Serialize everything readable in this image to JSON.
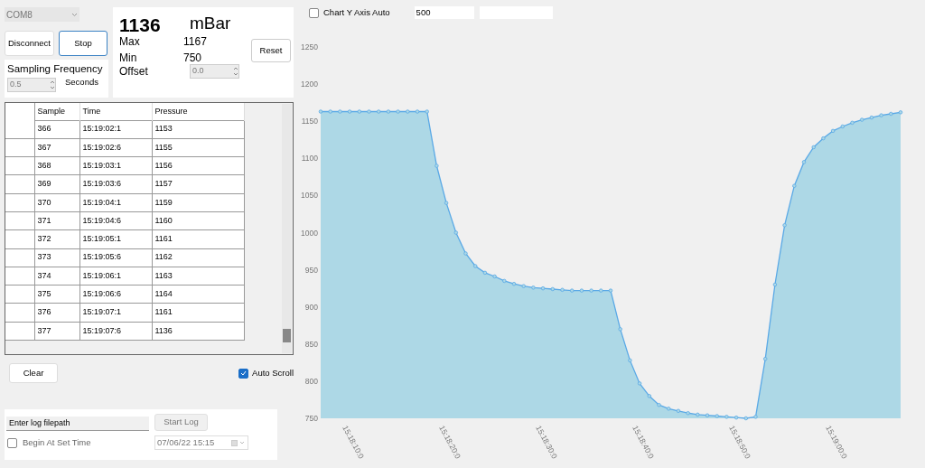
{
  "port_combo": {
    "value": "COM8"
  },
  "connection_buttons": [
    {
      "label": "Disconnect",
      "selected": false
    },
    {
      "label": "Stop",
      "selected": true
    }
  ],
  "sampling": {
    "title": "Sampling Frequency",
    "value": "0.5",
    "unit": "Seconds"
  },
  "reading": {
    "value": "1136",
    "unit": "mBar",
    "max_label": "Max",
    "max_value": "1167",
    "min_label": "Min",
    "min_value": "750",
    "offset_label": "Offset",
    "offset_value": "0.0",
    "reset_button": "Reset"
  },
  "table": {
    "columns": [
      "Sample",
      "Time",
      "Pressure"
    ],
    "rows": [
      [
        "366",
        "15:19:02:1",
        "1153"
      ],
      [
        "367",
        "15:19:02:6",
        "1155"
      ],
      [
        "368",
        "15:19:03:1",
        "1156"
      ],
      [
        "369",
        "15:19:03:6",
        "1157"
      ],
      [
        "370",
        "15:19:04:1",
        "1159"
      ],
      [
        "371",
        "15:19:04:6",
        "1160"
      ],
      [
        "372",
        "15:19:05:1",
        "1161"
      ],
      [
        "373",
        "15:19:05:6",
        "1162"
      ],
      [
        "374",
        "15:19:06:1",
        "1163"
      ],
      [
        "375",
        "15:19:06:6",
        "1164"
      ],
      [
        "376",
        "15:19:07:1",
        "1161"
      ],
      [
        "377",
        "15:19:07:6",
        "1136"
      ]
    ]
  },
  "clear_button": "Clear",
  "auto_scroll": {
    "label": "Auto Scroll",
    "checked": true
  },
  "log": {
    "filepath_placeholder": "Enter log filepath",
    "start_button": "Start Log",
    "begin_at_set_time": {
      "label": "Begin At Set Time",
      "checked": false
    },
    "datetime": "07/06/22 15:15"
  },
  "chart_options": {
    "y_axis_auto": {
      "label": "Chart Y Axis Auto",
      "checked": false
    },
    "range_value": "500"
  },
  "chart": {
    "chart_data": {
      "type": "area",
      "categories": [
        null,
        null,
        null,
        "15:18:10:0",
        null,
        null,
        null,
        null,
        null,
        null,
        null,
        null,
        null,
        "15:18:20:0",
        null,
        null,
        null,
        null,
        null,
        null,
        null,
        null,
        null,
        "15:18:30:0",
        null,
        null,
        null,
        null,
        null,
        null,
        null,
        null,
        null,
        "15:18:40:0",
        null,
        null,
        null,
        null,
        null,
        null,
        null,
        null,
        null,
        "15:18:50:0",
        null,
        null,
        null,
        null,
        null,
        null,
        null,
        null,
        null,
        "15:19:00:0",
        null,
        null,
        null,
        null,
        null,
        null,
        null
      ],
      "values": [
        1163,
        1163,
        1163,
        1163,
        1163,
        1163,
        1163,
        1163,
        1163,
        1163,
        1163,
        1163,
        1090,
        1040,
        1000,
        972,
        955,
        946,
        941,
        935,
        931,
        928,
        926,
        925,
        924,
        923,
        922,
        922,
        922,
        922,
        922,
        870,
        828,
        797,
        780,
        768,
        763,
        760,
        757,
        755,
        754,
        753,
        752,
        751,
        750,
        752,
        830,
        930,
        1010,
        1063,
        1095,
        1115,
        1127,
        1137,
        1143,
        1148,
        1152,
        1155,
        1158,
        1160,
        1162
      ],
      "ylim": [
        750,
        1250
      ],
      "yticks": [
        750,
        800,
        850,
        900,
        950,
        1000,
        1050,
        1100,
        1150,
        1200,
        1250
      ]
    }
  }
}
